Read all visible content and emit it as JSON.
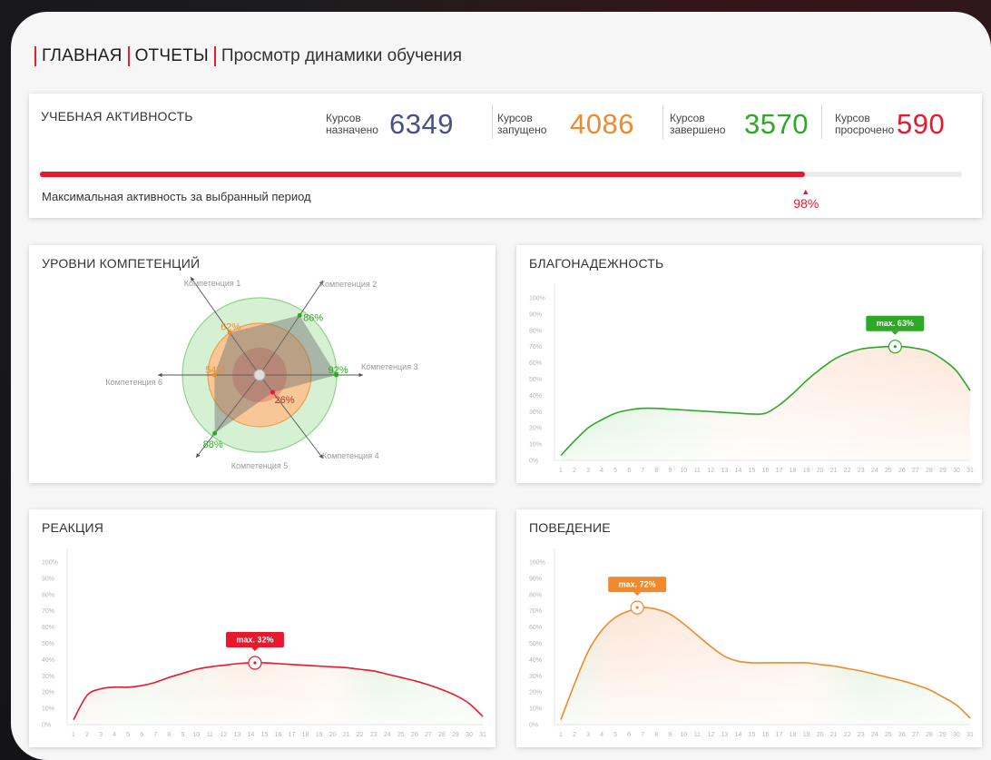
{
  "breadcrumb": {
    "home": "ГЛАВНАЯ",
    "reports": "ОТЧЕТЫ",
    "current": "Просмотр динамики обучения"
  },
  "activity": {
    "title": "УЧЕБНАЯ АКТИВНОСТЬ",
    "stats": [
      {
        "label": "Курсов назначено",
        "value": "6349",
        "color": "#48508a"
      },
      {
        "label": "Курсов запущено",
        "value": "4086",
        "color": "#f08a2c"
      },
      {
        "label": "Курсов завершено",
        "value": "3570",
        "color": "#2ea827"
      },
      {
        "label": "Курсов просрочено",
        "value": "590",
        "color": "#e8192c"
      }
    ],
    "progress_percent": 83,
    "caption": "Максимальная активность за выбранный период",
    "marker_value": "98%"
  },
  "colors": {
    "accent": "#e8192c",
    "green": "#2ea827",
    "orange": "#f08a2c",
    "blue": "#48508a"
  },
  "chart_data": [
    {
      "type": "radar",
      "title": "УРОВНИ  КОМПЕТЕНЦИЙ",
      "axes": [
        "Компетенция 1",
        "Компетенция 2",
        "Компетенция 3",
        "Компетенция 4",
        "Компетенция 5",
        "Компетенция 6"
      ],
      "value_labels": [
        {
          "axis": "Компетенция 1",
          "text": "62%",
          "color": "#f08a2c",
          "value": 62
        },
        {
          "axis": "Компетенция 2",
          "text": "86%",
          "color": "#2ea827",
          "value": 86
        },
        {
          "axis": "Компетенция 3",
          "text": "92%",
          "color": "#2ea827",
          "value": 92
        },
        {
          "axis": "Компетенция 4",
          "text": "26%",
          "color": "#e8192c",
          "value": 26
        },
        {
          "axis": "Компетенция 5",
          "text": "88%",
          "color": "#2ea827",
          "value": 88
        },
        {
          "axis": "Компетенция 6",
          "text": "54%",
          "color": "#f08a2c",
          "value": 54
        }
      ]
    },
    {
      "type": "area",
      "title": "БЛАГОНАДЕЖНОСТЬ",
      "color": "#2ea827",
      "x": [
        1,
        2,
        3,
        4,
        5,
        6,
        7,
        8,
        9,
        10,
        11,
        12,
        13,
        14,
        15,
        16,
        17,
        18,
        19,
        20,
        21,
        22,
        23,
        24,
        25,
        26,
        27,
        28,
        29,
        30,
        31
      ],
      "y": [
        3,
        12,
        20,
        25,
        29,
        31,
        32,
        32,
        31.5,
        31,
        30.5,
        30,
        29.5,
        29,
        28.5,
        29,
        34,
        41,
        49,
        56,
        62,
        66,
        68.5,
        69.5,
        70,
        70,
        69,
        67,
        62,
        55,
        43
      ],
      "ylim": [
        0,
        100
      ],
      "yticks": [
        "0%",
        "10%",
        "20%",
        "30%",
        "40%",
        "50%",
        "60%",
        "70%",
        "80%",
        "90%",
        "100%"
      ],
      "max": {
        "x": 25.5,
        "y": 70,
        "label": "max. 63%"
      }
    },
    {
      "type": "area",
      "title": "РЕАКЦИЯ",
      "color": "#e8192c",
      "x": [
        1,
        2,
        3,
        4,
        5,
        6,
        7,
        8,
        9,
        10,
        11,
        12,
        13,
        14,
        15,
        16,
        17,
        18,
        19,
        20,
        21,
        22,
        23,
        24,
        25,
        26,
        27,
        28,
        29,
        30,
        31
      ],
      "y": [
        3,
        18,
        22,
        23,
        23,
        24,
        26,
        29,
        31.5,
        34,
        35.5,
        36.5,
        37.5,
        38,
        38,
        37.5,
        37,
        36.5,
        36,
        35.5,
        35,
        34,
        33,
        31,
        29,
        27,
        24.5,
        21.5,
        18,
        13,
        5
      ],
      "ylim": [
        0,
        100
      ],
      "yticks": [
        "0%",
        "10%",
        "20%",
        "30%",
        "40%",
        "50%",
        "60%",
        "70%",
        "80%",
        "90%",
        "100%"
      ],
      "max": {
        "x": 14.3,
        "y": 38,
        "label": "max. 32%"
      }
    },
    {
      "type": "area",
      "title": "ПОВЕДЕНИЕ",
      "color": "#f08a2c",
      "x": [
        1,
        2,
        3,
        4,
        5,
        6,
        7,
        8,
        9,
        10,
        11,
        12,
        13,
        14,
        15,
        16,
        17,
        18,
        19,
        20,
        21,
        22,
        23,
        24,
        25,
        26,
        27,
        28,
        29,
        30,
        31
      ],
      "y": [
        3,
        25,
        45,
        58,
        66,
        70,
        72,
        71,
        68,
        62,
        55,
        48,
        42,
        39,
        38,
        38,
        38,
        38,
        38,
        37,
        36,
        34.5,
        33,
        31,
        29,
        27,
        24.5,
        21.5,
        17,
        12,
        4
      ],
      "ylim": [
        0,
        100
      ],
      "yticks": [
        "0%",
        "10%",
        "20%",
        "30%",
        "40%",
        "50%",
        "60%",
        "70%",
        "80%",
        "90%",
        "100%"
      ],
      "max": {
        "x": 6.6,
        "y": 72,
        "label": "max. 72%"
      }
    }
  ]
}
